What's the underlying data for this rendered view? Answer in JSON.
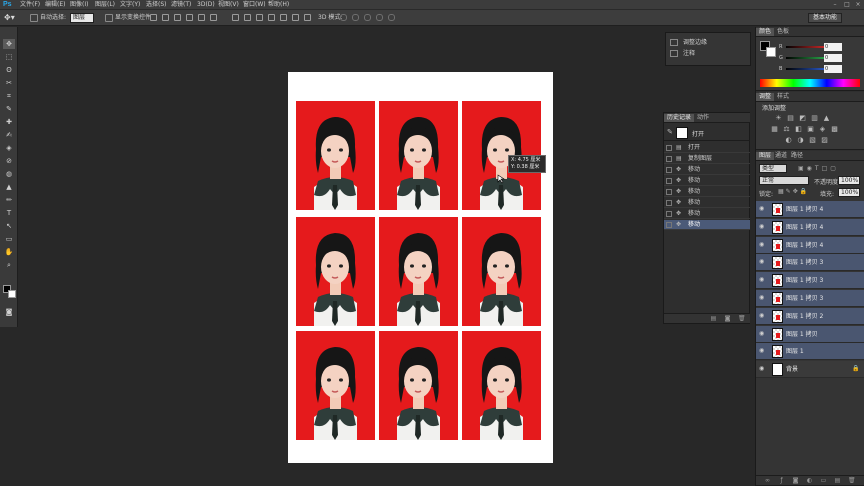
{
  "app": {
    "logo": "Ps"
  },
  "menu": [
    "文件(F)",
    "编辑(E)",
    "图像(I)",
    "图层(L)",
    "文字(Y)",
    "选择(S)",
    "滤镜(T)",
    "3D(D)",
    "视图(V)",
    "窗口(W)",
    "帮助(H)"
  ],
  "options_bar": {
    "auto_select_label": "自动选择:",
    "auto_select_value": "图层",
    "show_transform_label": "显示变换控件",
    "mode_3d_label": "3D 模式:",
    "workspace": "基本功能"
  },
  "mini_panel": {
    "items": [
      "调整边缘",
      "注释"
    ]
  },
  "history": {
    "tabs": [
      "历史记录",
      "动作"
    ],
    "snapshot_label": "打开",
    "items": [
      "打开",
      "复制图层",
      "移动",
      "移动",
      "移动",
      "移动",
      "移动",
      "移动"
    ]
  },
  "tooltip": {
    "line1": "X: 4.75 厘米",
    "line2": "Y: 0.38 厘米"
  },
  "color_panel": {
    "tabs": [
      "颜色",
      "色板"
    ],
    "channels": [
      {
        "label": "R",
        "value": "0",
        "color": "#cc2a2a"
      },
      {
        "label": "G",
        "value": "0",
        "color": "#2aa84a"
      },
      {
        "label": "B",
        "value": "0",
        "color": "#2a5acc"
      }
    ]
  },
  "adjust_panel": {
    "tabs": [
      "调整",
      "样式"
    ],
    "title": "添加调整",
    "row1": [
      "☀",
      "▤",
      "◩",
      "▥",
      "▲"
    ],
    "row2": [
      "▦",
      "⚖",
      "◧",
      "▣",
      "◈",
      "▩"
    ],
    "row3": [
      "◐",
      "◑",
      "▧",
      "▨"
    ]
  },
  "layers_panel": {
    "tabs": [
      "图层",
      "通道",
      "路径"
    ],
    "filter_label": "类型",
    "blend_mode": "正常",
    "opacity_label": "不透明度:",
    "opacity_value": "100%",
    "lock_label": "锁定:",
    "fill_label": "填充:",
    "fill_value": "100%",
    "layers": [
      {
        "name": "图层 1 拷贝 4",
        "checker": true
      },
      {
        "name": "图层 1 拷贝 4",
        "checker": true
      },
      {
        "name": "图层 1 拷贝 4",
        "checker": true
      },
      {
        "name": "图层 1 拷贝 3",
        "checker": true
      },
      {
        "name": "图层 1 拷贝 3",
        "checker": true
      },
      {
        "name": "图层 1 拷贝 3",
        "checker": true
      },
      {
        "name": "图层 1 拷贝 2",
        "checker": true
      },
      {
        "name": "图层 1 拷贝",
        "checker": true
      },
      {
        "name": "图层 1",
        "checker": true
      },
      {
        "name": "背景",
        "checker": false,
        "bg": true
      }
    ]
  },
  "photos": {
    "rows": 3,
    "cols": 3,
    "background_color": "#e51a1c"
  }
}
